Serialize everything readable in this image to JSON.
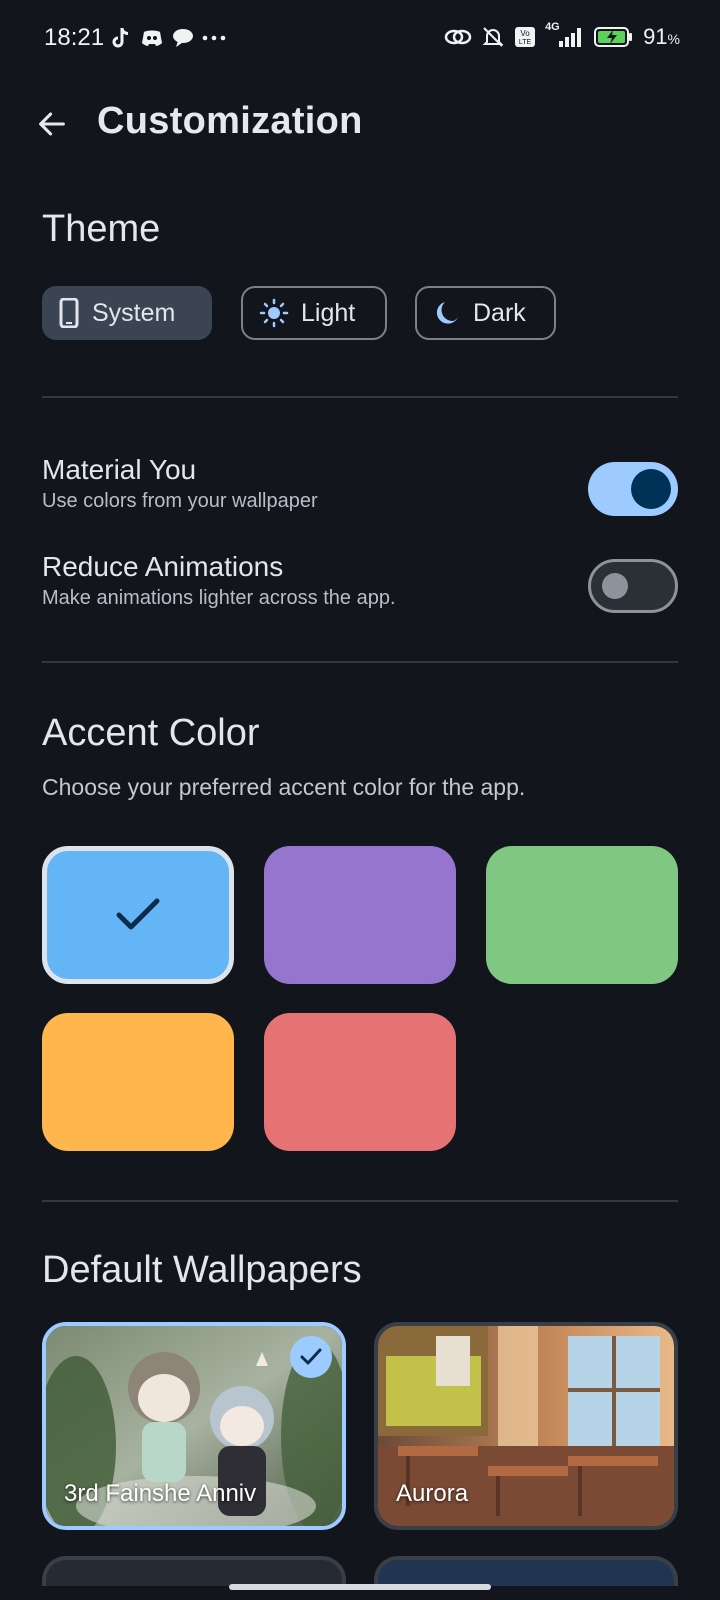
{
  "status_bar": {
    "time": "18:21",
    "battery_percent": "91",
    "battery_unit": "%",
    "network": "4G",
    "icons": [
      "tiktok-icon",
      "discord-icon",
      "chat-bubble-icon",
      "more-dots-icon",
      "link-icon",
      "bell-off-icon",
      "volte-icon",
      "signal-icon",
      "battery-charging-icon"
    ]
  },
  "app_bar": {
    "title": "Customization",
    "back_icon": "arrow-back-icon"
  },
  "theme": {
    "title": "Theme",
    "options": [
      {
        "label": "System",
        "icon": "phone-icon",
        "selected": true
      },
      {
        "label": "Light",
        "icon": "sun-icon",
        "selected": false
      },
      {
        "label": "Dark",
        "icon": "moon-icon",
        "selected": false
      }
    ]
  },
  "settings": {
    "material_you": {
      "title": "Material You",
      "subtitle": "Use colors from your wallpaper",
      "enabled": true
    },
    "reduce_animations": {
      "title": "Reduce Animations",
      "subtitle": "Make animations lighter across the app.",
      "enabled": false
    }
  },
  "accent": {
    "title": "Accent Color",
    "description": "Choose your preferred accent color for the app.",
    "selected_index": 0,
    "colors": [
      "#64b5f6",
      "#9575cd",
      "#81c784",
      "#ffb74d",
      "#e57373"
    ]
  },
  "wallpapers": {
    "title": "Default Wallpapers",
    "items": [
      {
        "label": "3rd Fainshe Anniv",
        "selected": true
      },
      {
        "label": "Aurora",
        "selected": false
      }
    ]
  },
  "colors": {
    "background": "#12151b",
    "primary": "#9ecbff",
    "on_primary": "#003258",
    "chip_selected": "#3b4452"
  }
}
